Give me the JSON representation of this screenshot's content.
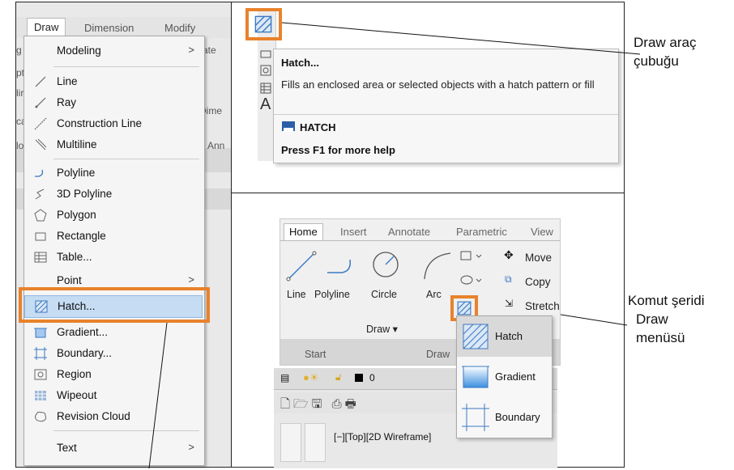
{
  "left_panel": {
    "menubar": [
      "Draw",
      "Dimension",
      "Modify"
    ],
    "partial_text_right": [
      "rate",
      "Dime",
      "Ann"
    ],
    "menu_items": [
      {
        "label": "Modeling",
        "icon": "none",
        "submenu": true
      },
      {
        "label": "Line",
        "icon": "line-icon"
      },
      {
        "label": "Ray",
        "icon": "ray-icon"
      },
      {
        "label": "Construction Line",
        "icon": "construction-line-icon"
      },
      {
        "label": "Multiline",
        "icon": "multiline-icon"
      },
      {
        "label": "Polyline",
        "icon": "polyline-icon"
      },
      {
        "label": "3D Polyline",
        "icon": "3d-polyline-icon"
      },
      {
        "label": "Polygon",
        "icon": "polygon-icon"
      },
      {
        "label": "Rectangle",
        "icon": "rectangle-icon"
      },
      {
        "label": "Table...",
        "icon": "table-icon"
      },
      {
        "label": "Point",
        "icon": "none",
        "submenu": true
      },
      {
        "label": "Hatch...",
        "icon": "hatch-icon",
        "highlighted": true
      },
      {
        "label": "Gradient...",
        "icon": "gradient-icon"
      },
      {
        "label": "Boundary...",
        "icon": "boundary-icon"
      },
      {
        "label": "Region",
        "icon": "region-icon"
      },
      {
        "label": "Wipeout",
        "icon": "wipeout-icon"
      },
      {
        "label": "Revision Cloud",
        "icon": "revision-cloud-icon"
      },
      {
        "label": "Text",
        "icon": "none",
        "submenu": true
      }
    ],
    "submenu_arrow": ">"
  },
  "tooltip": {
    "title": "Hatch...",
    "description": "Fills an enclosed area or selected objects with a hatch pattern or fill",
    "command": "HATCH",
    "help": "Press F1 for more help"
  },
  "callouts": {
    "toolbar_line1": "Draw araç",
    "toolbar_line2": "çubuğu",
    "ribbon_line1": "Komut şeridi",
    "ribbon_line2": "Draw",
    "ribbon_line3": "menüsü"
  },
  "ribbon": {
    "tabs": [
      "Home",
      "Insert",
      "Annotate",
      "Parametric",
      "View"
    ],
    "tools": [
      "Line",
      "Polyline",
      "Circle",
      "Arc"
    ],
    "modify": [
      "Move",
      "Copy",
      "Stretch"
    ],
    "panel_label": "Draw ▾",
    "start_tab": "Start",
    "draw_tab": "Draw",
    "layer_value": "0",
    "viewport_label": "[−][Top][2D Wireframe]",
    "gallery": [
      "Hatch",
      "Gradient",
      "Boundary"
    ]
  },
  "colors": {
    "accent": "#e8822c",
    "highlight": "#c5dcf3"
  }
}
